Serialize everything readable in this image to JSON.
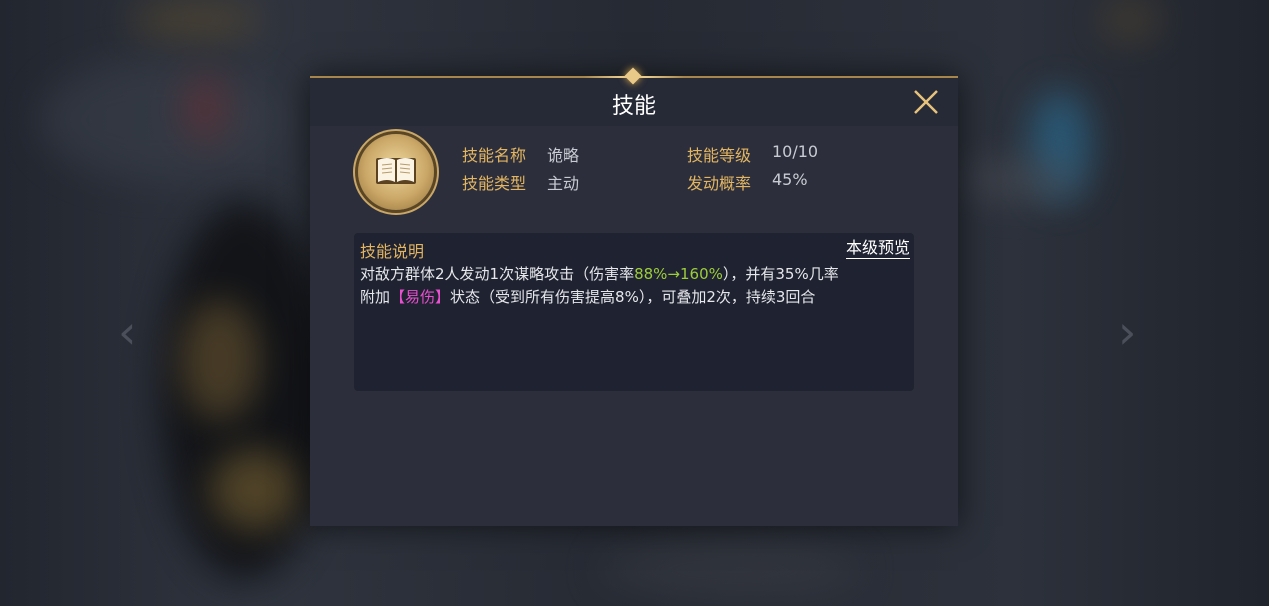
{
  "dialog": {
    "title": "技能",
    "close_icon": "close-icon"
  },
  "skill": {
    "icon": "book-icon",
    "name_label": "技能名称",
    "name_value": "诡略",
    "type_label": "技能类型",
    "type_value": "主动",
    "level_label": "技能等级",
    "level_value": "10/10",
    "chance_label": "发动概率",
    "chance_value": "45%"
  },
  "description": {
    "title": "技能说明",
    "preview_link": "本级预览",
    "line1_pre": "对敌方群体2人发动1次谋略攻击（伤害率",
    "line1_highlight": "88%→160%",
    "line1_post": "），并有35%几率",
    "line2_pre": "附加",
    "line2_highlight": "【易伤】",
    "line2_post": "状态（受到所有伤害提高8%），可叠加2次，持续3回合"
  },
  "colors": {
    "gold_label": "#e3b562",
    "highlight_green": "#9ccd3a",
    "highlight_pink": "#e94fd0",
    "dialog_bg": "#2c2f3b"
  }
}
